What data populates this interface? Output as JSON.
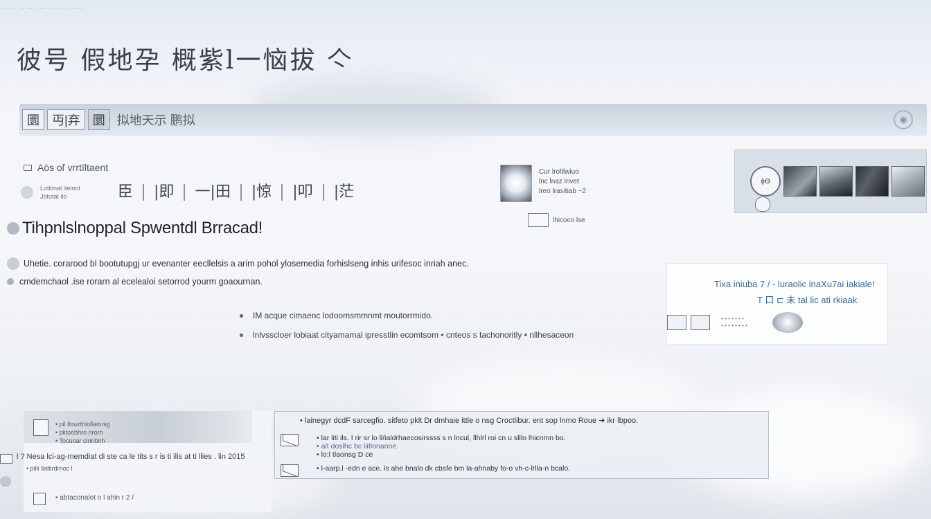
{
  "top_strip": "…… …… ……… ……",
  "headline": "彼号 假地孕 概紫l一恼拔 亽",
  "nav": {
    "tab1": "圜",
    "tab2": "丏|弃",
    "tab3": "圜",
    "breadcrumb": "拟地天示 鹏拟"
  },
  "section_header": "Aòs oľ vrrtīltaent",
  "meta": {
    "line1": "Lotitinat iteinot",
    "line2": "Jotutat ilo"
  },
  "columns": [
    "臣",
    "|即",
    "一|田",
    "|惊",
    "|叩",
    "|茫"
  ],
  "profile": {
    "line1": "Cur lroltlwiuo",
    "line2": "lnc lnaz lrivet",
    "line3": "lreo lrasitiab",
    "accent": "~2",
    "foot": "lhicoco lse"
  },
  "gallery": {
    "button_label": "ϕ⁠Ѳ"
  },
  "main_title": "Tihpnlslnoppal Spwentdl Brracad!",
  "paragraph1": "Uhetie. corarood bl bootutupgj ur evenanter eecllelsis a arim pohol ylosemedia forhislseng inhis urifesoc inriah anec.",
  "paragraph2": "cmdemchaol .ise rorarn al ecelealoi setorrod yourm goaournan.",
  "bullets": [
    "IM acque cimaenc lodoomsmmnmt moutorrmido.",
    "lnlvsscloer lobiaat cityamamal ipresstlin ecomtsom • cnteos s tachonoritly • nllhesaceon"
  ],
  "panel": {
    "line1": "Tixa iniuba 7 / - luraolic lnaXu7ai iakiale!",
    "line2": "T 口 ⊏ 未 tal lic ati rkiaak",
    "small1": "• • • • • • •",
    "small2": "• • • • • • • •"
  },
  "news_card": {
    "line1": "• pil llouzthiollamnig",
    "line2": "• plitoobhro rirorn",
    "line3": "• Tocuoar cirinbnh",
    "wide": "l ? Nesa lci-ag-memdiat di ste ca le tits s r is ti ilis  at ti llies . lin 2015",
    "small": "• pilli llaltirdrnoc l",
    "bottom": "• abtaconalot o l ahin r 2 /"
  },
  "feed": {
    "header": "• lainegyr dcdF sarcegfio. sitfeto pklt Dr dmhaie ittle o nsg Croctlibur. ent sop lnmo Roue ➜ ikr lbpoo.",
    "item1_line1": "• lar liti ils. I rir sr lo ll/ialdrhaecosirssss s n lncul, llhlrl roi  cn u  slllo lhicnmn bo.",
    "item1_line2": "• alt doslhc bc liitlonanne.",
    "item1_line3": "• lo:l tlaonsg D ce",
    "item2": "• l-aarp.l -edn e ace. ls ahe bnalo dk cbsfe bm la-ahnaby fo-o vh-c-lrlla-n bcalo."
  },
  "colors": {
    "accent": "#3467a8",
    "nav_bg": "#d7dee8",
    "text": "#2a2f38"
  },
  "icons": [
    "square-icon",
    "globe-icon",
    "image-button-icon",
    "document-icon",
    "envelope-icon",
    "hand-cursor-icon"
  ]
}
